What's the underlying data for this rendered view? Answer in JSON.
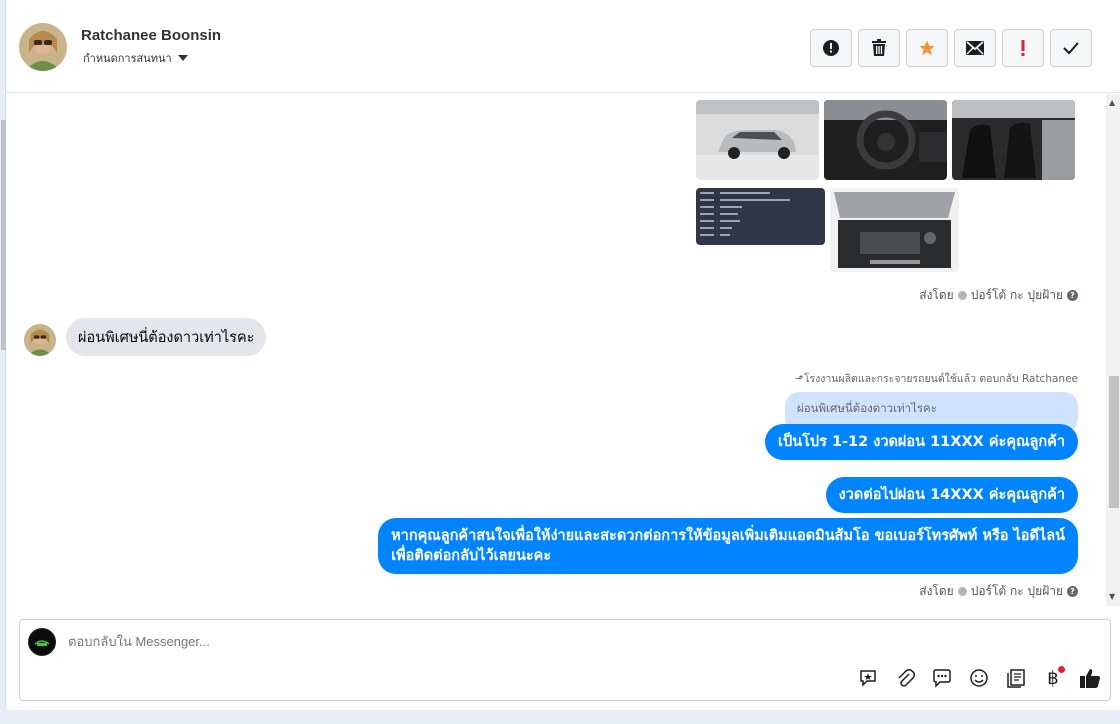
{
  "header": {
    "name": "Ratchanee Boonsin",
    "assign_label": "กำหนดการสนทนา",
    "actions": [
      {
        "name": "alert-circle-icon"
      },
      {
        "name": "trash-icon"
      },
      {
        "name": "star-icon",
        "color": "#f7923b"
      },
      {
        "name": "mail-icon"
      },
      {
        "name": "exclamation-icon",
        "color": "#e41e3f"
      },
      {
        "name": "checkmark-icon"
      }
    ]
  },
  "messages": {
    "sent_by_1": "ส่งโดย",
    "sender_1": "ปอร์โต้ กะ ปุยฝ้าย",
    "incoming_text": "ผ่อนพิเศษนี่ต้องดาวเท่าไรคะ",
    "reply_meta": "โรงงานผลิตและกระจายรถยนต์ใช้แล้ว ตอบกลับ Ratchanee",
    "quoted_text": "ผ่อนพิเศษนี่ต้องดาวเท่าไรคะ",
    "out_1": "เป็นโปร 1-12 งวดผ่อน 11XXX ค่ะคุณลูกค้า",
    "out_2": "งวดต่อไปผ่อน 14XXX ค่ะคุณลูกค้า",
    "out_3_line1": "หากคุณลูกค้าสนใจเพื่อให้ง่ายและสะดวกต่อการให้ข้อมูลเพิ่มเติมแอดมินส้มโอ ขอเบอร์โทรศัพท์ หรือ ไอดีไลน์",
    "out_3_line2": "เพื่อติดต่อกลับไว้เลยนะคะ",
    "sent_by_2": "ส่งโดย",
    "sender_2": "ปอร์โต้ กะ ปุยฝ้าย"
  },
  "composer": {
    "placeholder": "ตอบกลับใน Messenger...",
    "tools": [
      "saved-reply-icon",
      "paperclip-icon",
      "chat-bubble-icon",
      "emoji-icon",
      "notes-icon",
      "baht-icon",
      "thumbs-up-icon"
    ]
  },
  "colors": {
    "accent": "#0084ff",
    "bubble_in": "#e4e6eb",
    "quoted": "#cfe3ff"
  }
}
